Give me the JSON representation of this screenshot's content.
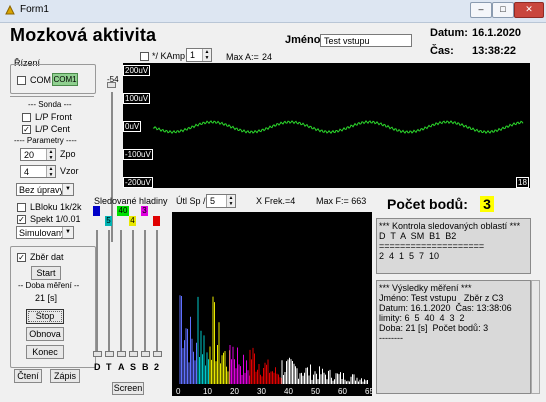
{
  "window": {
    "title": "Form1",
    "min": "–",
    "max": "□",
    "close": "✕"
  },
  "header": {
    "app_title": "Mozková aktivita",
    "name_label": "Jméno:",
    "name_value": "Test vstupu",
    "date_label": "Datum:",
    "date_value": "16.1.2020",
    "time_label": "Čas:",
    "time_value": "13:38:22"
  },
  "scope_controls": {
    "kamp_label": "*/ KAmp",
    "kamp_value": "1",
    "max_label": "Max A:=",
    "max_value": "24",
    "offset_label": "-54"
  },
  "scope": {
    "y_ticks": [
      "200uV",
      "100uV",
      "0uV",
      "-100uV",
      "-200uV"
    ],
    "corner": "18"
  },
  "left": {
    "rizeni": "Řízení",
    "com_checkbox": "COM",
    "com_value": "COM1",
    "sonda_header": "--- Sonda ---",
    "lp_front": "L/P Front",
    "lp_cent": "L/P Cent",
    "parametry_header": "---- Parametry ----",
    "zpo_value": "20",
    "zpo_label": "Zpo",
    "vzor_value": "4",
    "vzor_label": "Vzor",
    "uprava_value": "Bez úpravy",
    "lbloku": "LBloku 1k/2k",
    "spekt": "Spekt 1/0.01",
    "simul_value": "Simulovaný",
    "zber_dat": "Zběr dat",
    "start": "Start",
    "doba_mereni": "-- Doba měření --",
    "doba_value": "21 [s]",
    "stop": "Stop",
    "obnova": "Obnova",
    "konec": "Konec",
    "cteni": "Čtení",
    "zapis": "Zápis"
  },
  "spectrum": {
    "sled_label": "Sledované hladiny",
    "utl_label": "Útl Sp /",
    "utl_value": "5",
    "xfrek_label": "X Frek.=4",
    "maxf_label": "Max F:= 663",
    "x_ticks": [
      "0",
      "10",
      "20",
      "30",
      "40",
      "50",
      "60",
      "65"
    ],
    "channels": [
      "D",
      "T",
      "A",
      "S",
      "B",
      "2"
    ],
    "channel_markers": [
      {
        "text": "",
        "color": "#0000c8"
      },
      {
        "text": "5",
        "color": "#00b4b4"
      },
      {
        "text": "40",
        "color": "#00e000"
      },
      {
        "text": "4",
        "color": "#e8e800"
      },
      {
        "text": "3",
        "color": "#e000e0"
      },
      {
        "text": "",
        "color": "#e00000"
      }
    ],
    "screen_button": "Screen"
  },
  "pocet": {
    "label": "Počet bodů:",
    "value": "3"
  },
  "memo1": {
    "lines": [
      "*** Kontrola sledovaných oblastí ***",
      "D  T  A  SM  B1  B2",
      "====================",
      "2  4  1  5  7  10"
    ]
  },
  "memo2": {
    "lines": [
      "*** Výsledky měření ***",
      "Jméno: Test vstupu   Zběr z C3",
      "Datum: 16.1.2020  Čas: 13:38:06",
      "limity: 6  5  40  4  3  2",
      "Doba: 21 [s]  Počet bodů: 3",
      "--------"
    ]
  },
  "colors": {
    "signal": "#2bd62b",
    "scope_bg": "#000000",
    "pocet_bg": "#ffff00"
  }
}
